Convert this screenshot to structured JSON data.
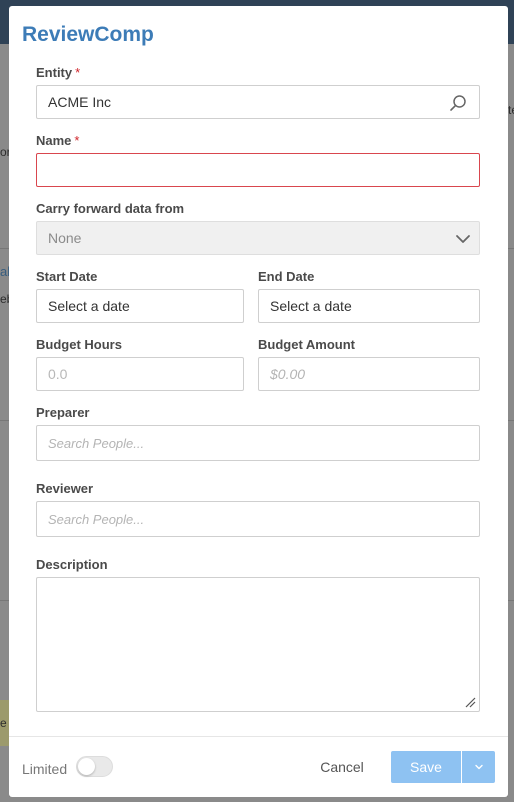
{
  "backdrop": {
    "fragment_right_1": "te",
    "fragment_left_1": "or",
    "fragment_left_link": "al",
    "fragment_left_2": "eb",
    "fragment_left_3": "e"
  },
  "modal": {
    "title": "ReviewComp",
    "entity": {
      "label": "Entity",
      "required_mark": "*",
      "value": "ACME Inc"
    },
    "name": {
      "label": "Name",
      "required_mark": "*",
      "value": ""
    },
    "carry_forward": {
      "label": "Carry forward data from",
      "value": "None"
    },
    "start_date": {
      "label": "Start Date",
      "value": "Select a date"
    },
    "end_date": {
      "label": "End Date",
      "value": "Select a date"
    },
    "budget_hours": {
      "label": "Budget Hours",
      "placeholder": "0.0"
    },
    "budget_amount": {
      "label": "Budget Amount",
      "placeholder": "$0.00"
    },
    "preparer": {
      "label": "Preparer",
      "placeholder": "Search People..."
    },
    "reviewer": {
      "label": "Reviewer",
      "placeholder": "Search People..."
    },
    "description": {
      "label": "Description",
      "value": ""
    }
  },
  "footer": {
    "limited_label": "Limited",
    "limited_on": false,
    "cancel_label": "Cancel",
    "save_label": "Save"
  },
  "colors": {
    "title": "#3d7cb7",
    "required": "#d0252b",
    "error_border": "#d9464e",
    "save_button": "#8ec2f2"
  }
}
